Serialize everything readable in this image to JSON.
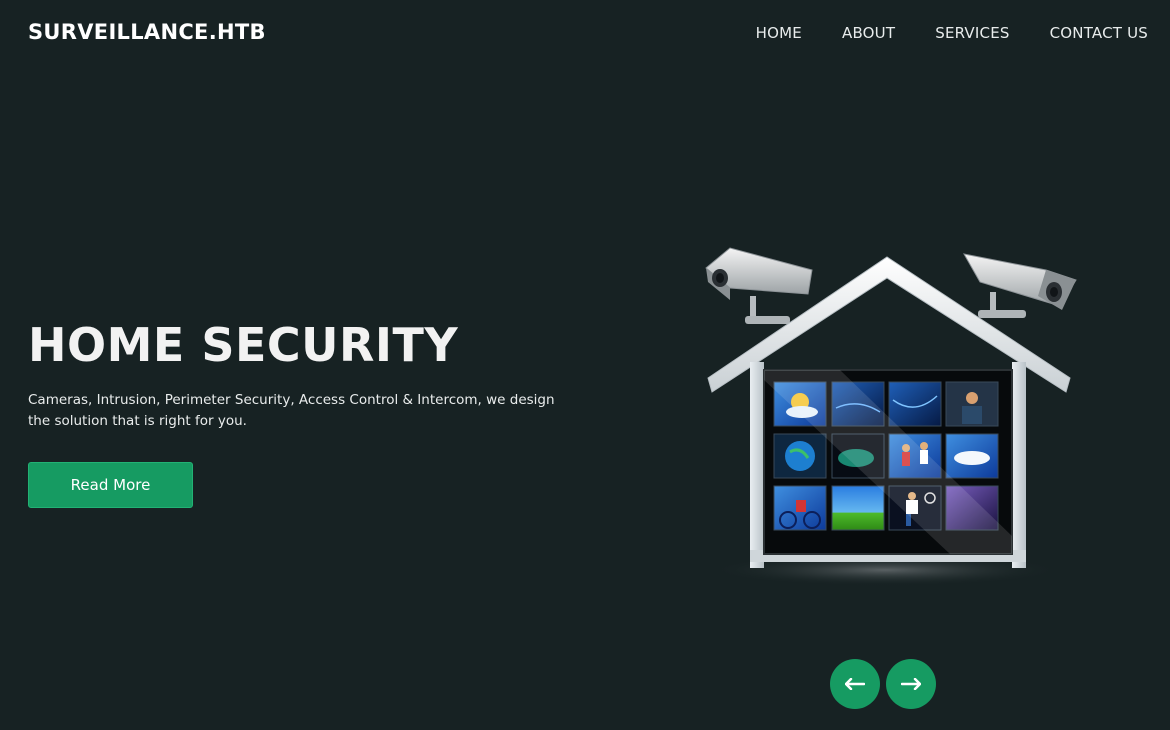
{
  "header": {
    "brand": "SURVEILLANCE.HTB",
    "nav": [
      {
        "label": "HOME"
      },
      {
        "label": "ABOUT"
      },
      {
        "label": "SERVICES"
      },
      {
        "label": "CONTACT US"
      }
    ]
  },
  "hero": {
    "title": "HOME SECURITY",
    "description": "Cameras, Intrusion, Perimeter Security, Access Control & Intercom, we design the solution that is right for you.",
    "cta_label": "Read More",
    "illustration_icon": "house-with-cameras-icon"
  },
  "carousel": {
    "prev_icon": "arrow-left-icon",
    "next_icon": "arrow-right-icon"
  },
  "colors": {
    "background": "#172223",
    "accent": "#169b62"
  }
}
